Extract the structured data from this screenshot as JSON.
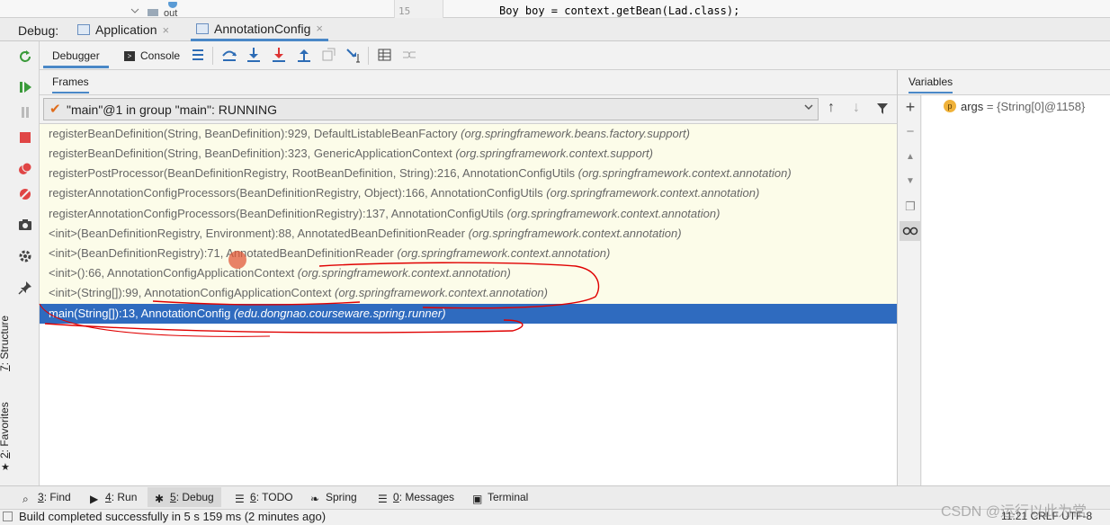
{
  "editor": {
    "line_number": "15",
    "code_line": "Boy boy = context.getBean(Lad.class);"
  },
  "debug_bar": {
    "label": "Debug:",
    "tabs": [
      {
        "label": "Application"
      },
      {
        "label": "AnnotationConfig"
      }
    ]
  },
  "toolbar": {
    "debugger_tab": "Debugger",
    "console_tab": "Console"
  },
  "frames": {
    "header": "Frames",
    "thread": "\"main\"@1 in group \"main\": RUNNING",
    "rows": [
      {
        "method": "registerBeanDefinition(String, BeanDefinition):929, DefaultListableBeanFactory ",
        "pkg": "(org.springframework.beans.factory.support)"
      },
      {
        "method": "registerBeanDefinition(String, BeanDefinition):323, GenericApplicationContext ",
        "pkg": "(org.springframework.context.support)"
      },
      {
        "method": "registerPostProcessor(BeanDefinitionRegistry, RootBeanDefinition, String):216, AnnotationConfigUtils ",
        "pkg": "(org.springframework.context.annotation)"
      },
      {
        "method": "registerAnnotationConfigProcessors(BeanDefinitionRegistry, Object):166, AnnotationConfigUtils ",
        "pkg": "(org.springframework.context.annotation)"
      },
      {
        "method": "registerAnnotationConfigProcessors(BeanDefinitionRegistry):137, AnnotationConfigUtils ",
        "pkg": "(org.springframework.context.annotation)"
      },
      {
        "method": "<init>(BeanDefinitionRegistry, Environment):88, AnnotatedBeanDefinitionReader ",
        "pkg": "(org.springframework.context.annotation)"
      },
      {
        "method": "<init>(BeanDefinitionRegistry):71, AnnotatedBeanDefinitionReader ",
        "pkg": "(org.springframework.context.annotation)"
      },
      {
        "method": "<init>():66, AnnotationConfigApplicationContext ",
        "pkg": "(org.springframework.context.annotation)"
      },
      {
        "method": "<init>(String[]):99, AnnotationConfigApplicationContext ",
        "pkg": "(org.springframework.context.annotation)"
      },
      {
        "method": "main(String[]):13, AnnotationConfig ",
        "pkg": "(edu.dongnao.courseware.spring.runner)",
        "selected": true
      }
    ]
  },
  "variables": {
    "header": "Variables",
    "items": [
      {
        "badge": "p",
        "name": "args",
        "value": " = {String[0]@1158}"
      }
    ]
  },
  "tool_tabs": [
    {
      "key": "3",
      "label": ": Find"
    },
    {
      "key": "4",
      "label": ": Run"
    },
    {
      "key": "5",
      "label": ": Debug"
    },
    {
      "key": "6",
      "label": ": TODO"
    },
    {
      "key": "",
      "label": "Spring"
    },
    {
      "key": "0",
      "label": ": Messages"
    },
    {
      "key": "",
      "label": "Terminal"
    }
  ],
  "side_tabs": {
    "structure_key": "7",
    "structure": ": Structure",
    "favorites_key": "2",
    "favorites": ": Favorites"
  },
  "status": {
    "text": "Build completed successfully in 5 s 159 ms (2 minutes ago)",
    "right": "11:21  CRLF  UTF-8"
  },
  "watermark": "CSDN @运行以此为常",
  "colors": {
    "selection": "#2f6bbf",
    "frames_bg": "#fcfce9",
    "accent": "#4a88c7",
    "annotation": "#e00000"
  }
}
